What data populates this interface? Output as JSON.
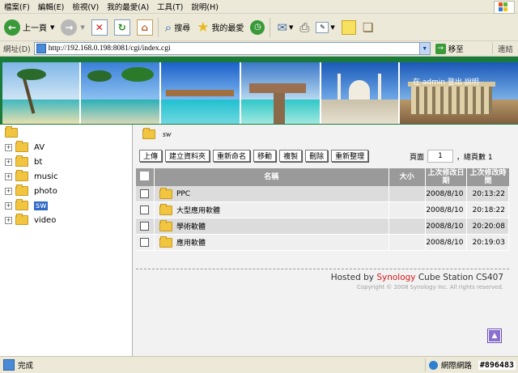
{
  "browser": {
    "menu": [
      "檔案(F)",
      "編輯(E)",
      "檢視(V)",
      "我的最愛(A)",
      "工具(T)",
      "說明(H)"
    ],
    "toolbar": {
      "back_label": "上一頁",
      "search_label": "搜尋",
      "favorites_label": "我的最愛"
    },
    "address": {
      "label": "網址(D)",
      "url": "http://192.168.0.198:8081/cgi/index.cgi",
      "go_label": "移至",
      "links_label": "連結"
    },
    "status": {
      "text": "完成",
      "zone": "網際網路",
      "watermark": "#896483"
    }
  },
  "app": {
    "user_info": "在 admin 登出 說明",
    "tree": {
      "items": [
        {
          "label": "AV"
        },
        {
          "label": "bt"
        },
        {
          "label": "music"
        },
        {
          "label": "photo"
        },
        {
          "label": "sw",
          "selected": true
        },
        {
          "label": "video"
        }
      ]
    },
    "current_path": "sw",
    "buttons": [
      "上傳",
      "建立資料夾",
      "重新命名",
      "移動",
      "複製",
      "刪除",
      "重新整理"
    ],
    "pager": {
      "page_label": "頁面",
      "page_value": "1",
      "total_label": "總頁數 1"
    },
    "table": {
      "headers": {
        "name": "名稱",
        "size": "大小",
        "mod_date": "上次修改日期",
        "mod_time": "上次修改時間"
      },
      "rows": [
        {
          "name": "PPC",
          "size": "",
          "date": "2008/8/10",
          "time": "20:13:22"
        },
        {
          "name": "大型應用軟體",
          "size": "",
          "date": "2008/8/10",
          "time": "20:18:22"
        },
        {
          "name": "學術軟體",
          "size": "",
          "date": "2008/8/10",
          "time": "20:20:08"
        },
        {
          "name": "應用軟體",
          "size": "",
          "date": "2008/8/10",
          "time": "20:19:03"
        }
      ]
    },
    "footer": {
      "hosted_prefix": "Hosted by",
      "brand": "Synology",
      "product": "Cube Station CS407",
      "copyright": "Copyright © 2008 Synology Inc. All rights reserved."
    }
  },
  "colors": {
    "banner_green": "#1a7a3a",
    "selection_blue": "#316ac5",
    "brand_red": "#d61a1a",
    "header_gray": "#9a9a9a"
  }
}
